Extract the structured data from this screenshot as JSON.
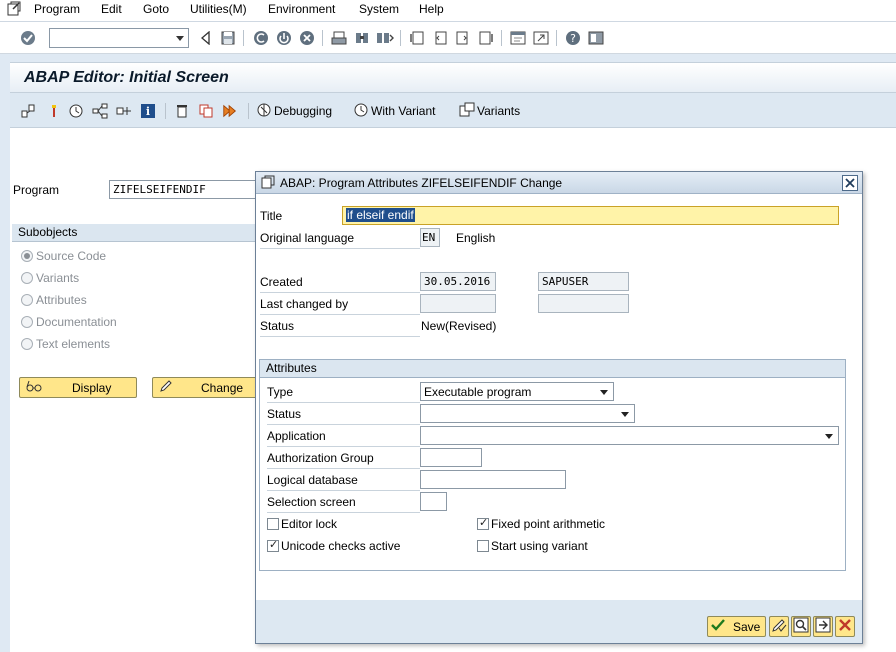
{
  "menu": {
    "items": [
      "Program",
      "Edit",
      "Goto",
      "Utilities(M)",
      "Environment",
      "System",
      "Help"
    ]
  },
  "title": "ABAP Editor: Initial Screen",
  "app_toolbar": {
    "debugging_label": "Debugging",
    "with_variant_label": "With Variant",
    "variants_label": "Variants"
  },
  "main": {
    "program_label": "Program",
    "program_value": "ZIFELSEIFENDIF",
    "subobjects_label": "Subobjects",
    "subobjects": [
      "Source Code",
      "Variants",
      "Attributes",
      "Documentation",
      "Text elements"
    ],
    "selected_subobject": "Source Code",
    "display_label": "Display",
    "change_label": "Change"
  },
  "dialog": {
    "title": "ABAP: Program Attributes ZIFELSEIFENDIF Change",
    "title_label": "Title",
    "title_value": "if elseif endif",
    "orig_lang_label": "Original language",
    "orig_lang_code": "EN",
    "orig_lang_name": "English",
    "created_label": "Created",
    "created_date": "30.05.2016",
    "created_user": "SAPUSER",
    "last_changed_label": "Last changed by",
    "status_label": "Status",
    "status_value": "New(Revised)",
    "attributes": {
      "header": "Attributes",
      "type_label": "Type",
      "type_value": "Executable program",
      "status_label": "Status",
      "application_label": "Application",
      "auth_group_label": "Authorization Group",
      "logical_db_label": "Logical database",
      "selection_screen_label": "Selection screen",
      "editor_lock_label": "Editor lock",
      "editor_lock_checked": false,
      "fixed_point_label": "Fixed point arithmetic",
      "fixed_point_checked": true,
      "unicode_label": "Unicode checks active",
      "unicode_checked": true,
      "start_variant_label": "Start using variant",
      "start_variant_checked": false
    },
    "save_label": "Save"
  },
  "colors": {
    "accent_yellow": "#ffe68a",
    "panel_blue": "#dde8f2",
    "title_field_bg": "#fff3a8"
  }
}
